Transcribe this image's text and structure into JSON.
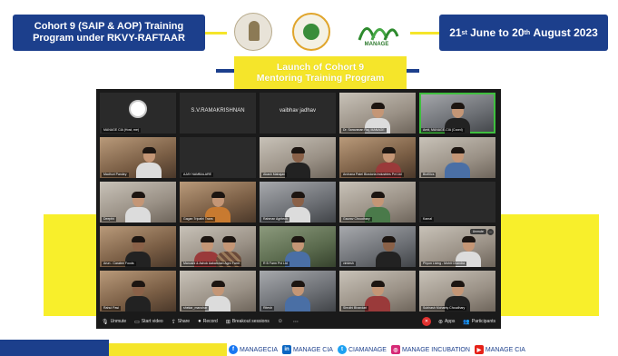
{
  "header": {
    "cohort_line1": "Cohort 9 (SAIP & AOP) Training",
    "cohort_line2": "Program under RKVY-RAFTAAR",
    "date_start_day": "21",
    "date_start_sup": "st",
    "date_start_month": "June to",
    "date_end_day": "20",
    "date_end_sup": "th",
    "date_end_rest": "August 2023",
    "leaf_logo_text": "MANAGE",
    "colors": {
      "navy": "#1c3f8c",
      "yellow": "#f5e52a"
    }
  },
  "launch": {
    "line1": "Launch of Cohort 9",
    "line2": "Mentoring Training Program"
  },
  "meeting": {
    "participants": [
      {
        "label": "MANAGE CIA (Host, me)",
        "type": "logo"
      },
      {
        "label": "",
        "type": "name",
        "display": "S.V.RAMAKRISHNAN"
      },
      {
        "label": "",
        "type": "name",
        "display": "vaibhav jadhav"
      },
      {
        "label": "Dr. Saravanan Raj, MANAGE",
        "type": "video"
      },
      {
        "label": "Amit, MANAGE-CIA (Coord)",
        "type": "video"
      },
      {
        "label": "Madhuri Pandey",
        "type": "video"
      },
      {
        "label": "AJAY NAMBALARE",
        "type": "dark"
      },
      {
        "label": "Akash Mahajan",
        "type": "video"
      },
      {
        "label": "Archana Patel Biostoria Industries Pvt Ltd",
        "type": "video"
      },
      {
        "label": "BioKlics",
        "type": "video"
      },
      {
        "label": "Deepthi",
        "type": "video"
      },
      {
        "label": "Gagan Tripathi Trans",
        "type": "video"
      },
      {
        "label": "Rahman Agritech",
        "type": "video"
      },
      {
        "label": "Gaurav Choudhary",
        "type": "video"
      },
      {
        "label": "Kamal",
        "type": "dark"
      },
      {
        "label": "Arun - Caratee Foods",
        "type": "video"
      },
      {
        "label": "Manushi & Ashok Aakarshan Agro Farm",
        "type": "video"
      },
      {
        "label": "R B Farm Pvt Ltd",
        "type": "video"
      },
      {
        "label": "vimlesh",
        "type": "video"
      },
      {
        "label": "Phyon Living - Mohit Chandra",
        "type": "video"
      },
      {
        "label": "Rahul Pasi",
        "type": "video"
      },
      {
        "label": "shekar_manohar",
        "type": "video"
      },
      {
        "label": "Ritesh",
        "type": "video"
      },
      {
        "label": "Shruthi Bhandari",
        "type": "video"
      },
      {
        "label": "Subhash Mohanty Choudhary",
        "type": "video"
      }
    ],
    "tile_button": "Unmute",
    "toolbar": {
      "unmute": "Unmute",
      "start_video": "Start video",
      "share": "Share",
      "record": "Record",
      "breakout": "Breakout sessions",
      "apps": "Apps",
      "participants": "Participants",
      "participants_count": "25"
    }
  },
  "social": {
    "facebook": "MANAGECIA",
    "linkedin": "MANAGE CIA",
    "twitter": "CIAMANAGE",
    "instagram": "MANAGE INCUBATION",
    "youtube": "MANAGE CIA"
  }
}
